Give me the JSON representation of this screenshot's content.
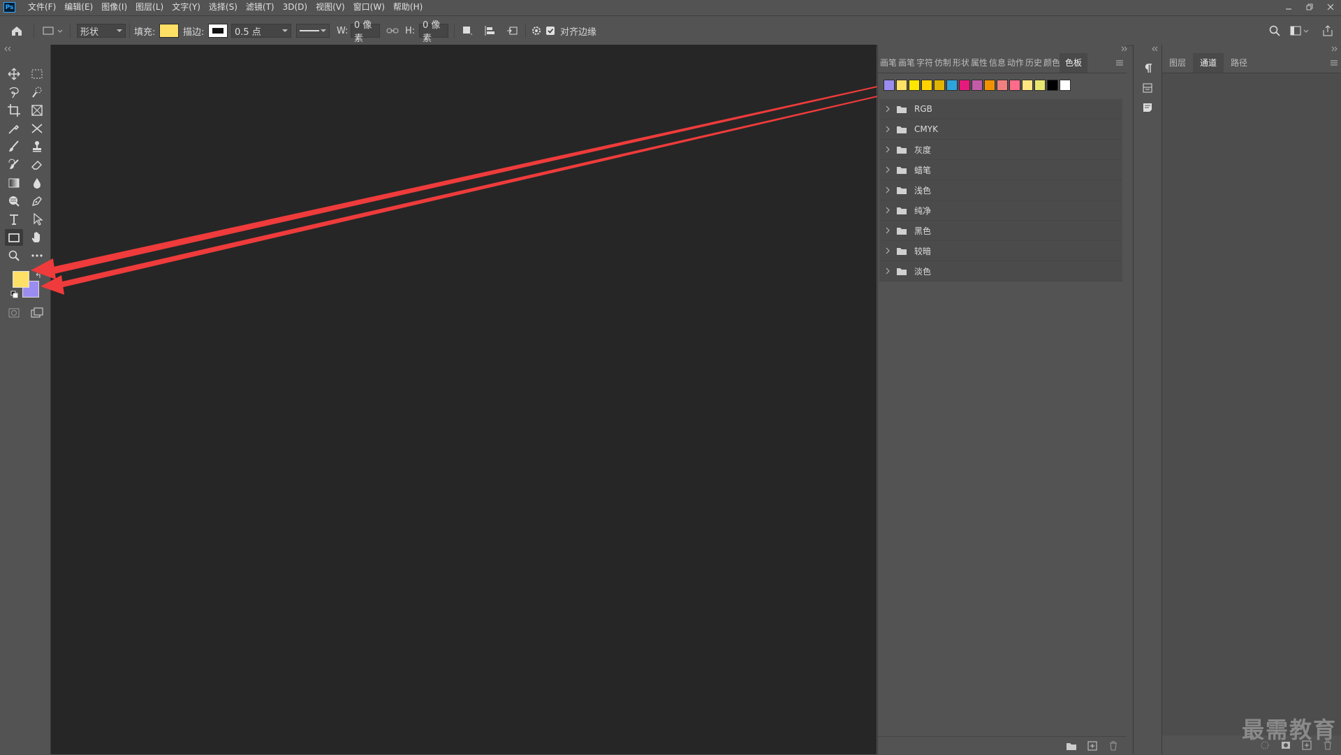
{
  "app": {
    "logo_text": "Ps"
  },
  "menu": [
    "文件(F)",
    "编辑(E)",
    "图像(I)",
    "图层(L)",
    "文字(Y)",
    "选择(S)",
    "滤镜(T)",
    "3D(D)",
    "视图(V)",
    "窗口(W)",
    "帮助(H)"
  ],
  "options": {
    "mode": "形状",
    "fill_label": "填充:",
    "fill_color": "#ffe066",
    "stroke_label": "描边:",
    "stroke_width": "0.5 点",
    "w_label": "W:",
    "w_value": "0 像素",
    "h_label": "H:",
    "h_value": "0 像素",
    "align_edges_label": "对齐边缘",
    "align_edges_checked": true
  },
  "colors": {
    "foreground": "#ffe066",
    "background": "#9b8cf2",
    "canvas": "#262626",
    "arrow": "#ef3b3b"
  },
  "swatches_panel": {
    "tabs": [
      "画笔",
      "画笔",
      "字符",
      "仿制",
      "形状",
      "属性",
      "信息",
      "动作",
      "历史",
      "颜色",
      "色板"
    ],
    "active_tab": "色板",
    "recent_swatches": [
      "#9b8cf2",
      "#ffe066",
      "#ffe600",
      "#ffd200",
      "#e0b400",
      "#2ea3dc",
      "#e6197c",
      "#c35ca8",
      "#f39200",
      "#f08080",
      "#ff6b8a",
      "#ffe680",
      "#e8e870",
      "#000000",
      "#ffffff"
    ],
    "groups": [
      "RGB",
      "CMYK",
      "灰度",
      "蜡笔",
      "浅色",
      "纯净",
      "黑色",
      "较暗",
      "淡色"
    ]
  },
  "layers_panel": {
    "tabs": [
      "图层",
      "通道",
      "路径"
    ],
    "active_tab": "通道"
  },
  "watermark": "最需教育"
}
